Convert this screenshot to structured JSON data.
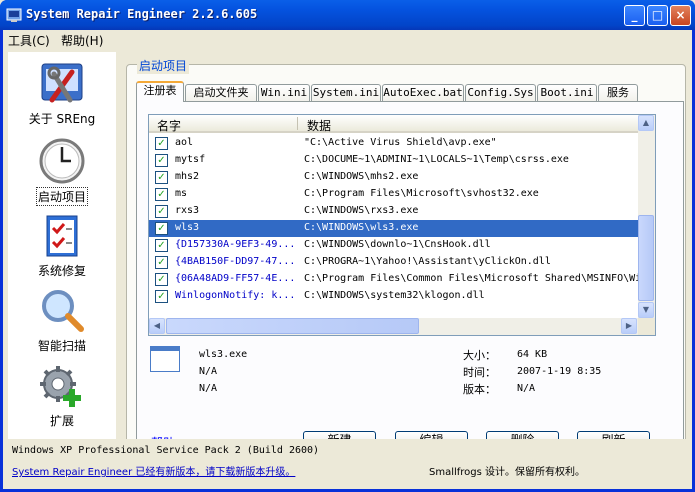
{
  "window": {
    "title": "System Repair Engineer 2.2.6.605",
    "minimize": "_",
    "maximize": "□",
    "close": "×"
  },
  "menu": {
    "tools": "工具(C)",
    "help": "帮助(H)"
  },
  "nav": [
    {
      "label": "关于 SREng",
      "icon": "tools-icon"
    },
    {
      "label": "启动项目",
      "icon": "clock-icon"
    },
    {
      "label": "系统修复",
      "icon": "checklist-icon"
    },
    {
      "label": "智能扫描",
      "icon": "magnifier-icon"
    },
    {
      "label": "扩展",
      "icon": "gear-plus-icon"
    }
  ],
  "group_title": "启动项目",
  "tabs": [
    "注册表",
    "启动文件夹",
    "Win.ini",
    "System.ini",
    "AutoExec.bat",
    "Config.Sys",
    "Boot.ini",
    "服务"
  ],
  "list": {
    "columns": [
      "名字",
      "数据"
    ],
    "rows": [
      {
        "name": "aol",
        "data": "\"C:\\Active Virus Shield\\avp.exe\"",
        "checked": true
      },
      {
        "name": "mytsf",
        "data": "C:\\DOCUME~1\\ADMINI~1\\LOCALS~1\\Temp\\csrss.exe",
        "checked": true
      },
      {
        "name": "mhs2",
        "data": "C:\\WINDOWS\\mhs2.exe",
        "checked": true
      },
      {
        "name": "ms",
        "data": "C:\\Program Files\\Microsoft\\svhost32.exe",
        "checked": true
      },
      {
        "name": "rxs3",
        "data": "C:\\WINDOWS\\rxs3.exe",
        "checked": true
      },
      {
        "name": "wls3",
        "data": "C:\\WINDOWS\\wls3.exe",
        "checked": true,
        "selected": true
      },
      {
        "name": "{D157330A-9EF3-49...",
        "data": "C:\\WINDOWS\\downlo~1\\CnsHook.dll",
        "checked": true
      },
      {
        "name": "{4BAB150F-DD97-47...",
        "data": "C:\\PROGRA~1\\Yahoo!\\Assistant\\yClickOn.dll",
        "checked": true
      },
      {
        "name": "{06A48AD9-FF57-4E...",
        "data": "C:\\Program Files\\Common Files\\Microsoft Shared\\MSINFO\\Wi",
        "checked": true
      },
      {
        "name": "WinlogonNotify: k...",
        "data": "C:\\WINDOWS\\system32\\klogon.dll",
        "checked": true
      }
    ]
  },
  "details": {
    "filename": "wls3.exe",
    "company": "N/A",
    "description": "N/A",
    "size_label": "大小：",
    "size": "64 KB",
    "time_label": "时间：",
    "time": "2007-1-19 8:35",
    "version_label": "版本：",
    "version": "N/A"
  },
  "buttons": {
    "help": "帮助",
    "new": "新建",
    "edit": "编辑",
    "delete": "删除",
    "refresh": "刷新"
  },
  "status": {
    "os": "Windows XP Professional Service Pack 2 (Build 2600)",
    "update": "System Repair Engineer 已经有新版本，请下载新版本升级。",
    "copyright": "Smallfrogs 设计。保留所有权利。"
  },
  "colors": {
    "titlebar": "#0553e0",
    "selection": "#316ac5",
    "accent_tab": "#f4a938",
    "link": "#0000ff"
  }
}
